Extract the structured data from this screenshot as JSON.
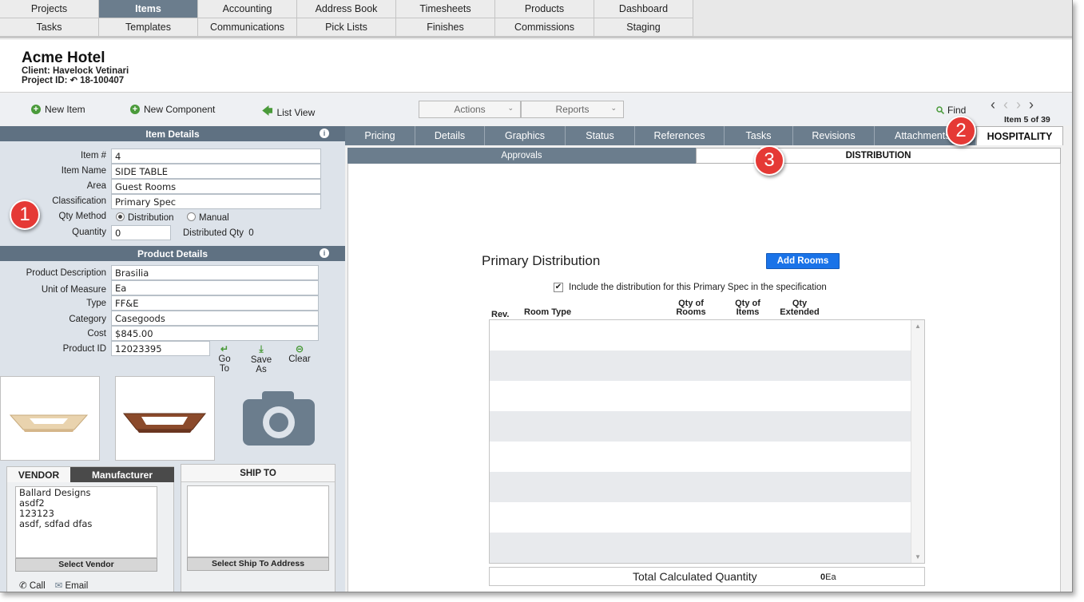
{
  "topnav": {
    "row1": [
      "Projects",
      "Items",
      "Accounting",
      "Address Book",
      "Timesheets",
      "Products",
      "Dashboard"
    ],
    "row2": [
      "Tasks",
      "Templates",
      "Communications",
      "Pick Lists",
      "Finishes",
      "Commissions",
      "Staging"
    ],
    "active": "Items"
  },
  "header": {
    "title": "Acme Hotel",
    "client": "Client: Havelock Vetinari",
    "project_label": "Project ID:",
    "project_id": "18-100407"
  },
  "toolbar": {
    "new_item": "New Item",
    "new_component": "New Component",
    "list_view": "List View",
    "actions": "Actions",
    "reports": "Reports",
    "find": "Find",
    "item_count": "Item 5 of 39"
  },
  "item_details": {
    "title": "Item Details",
    "fields": [
      {
        "label": "Item #",
        "value": "4"
      },
      {
        "label": "Item Name",
        "value": "SIDE TABLE"
      },
      {
        "label": "Area",
        "value": "Guest Rooms"
      },
      {
        "label": "Classification",
        "value": "Primary Spec"
      }
    ],
    "qty_method_label": "Qty Method",
    "qty_method_options": [
      "Distribution",
      "Manual"
    ],
    "qty_method_selected": "Distribution",
    "quantity_label": "Quantity",
    "quantity_value": "0",
    "distributed_qty_label": "Distributed Qty",
    "distributed_qty_value": "0"
  },
  "product_details": {
    "title": "Product Details",
    "fields": [
      {
        "label": "Product Description",
        "value": "Brasilia"
      },
      {
        "label": "Unit of Measure",
        "value": "Ea"
      },
      {
        "label": "Type",
        "value": "FF&E"
      },
      {
        "label": "Category",
        "value": "Casegoods"
      },
      {
        "label": "Cost",
        "value": "$845.00"
      }
    ],
    "product_id_label": "Product ID",
    "product_id_value": "12023395",
    "actions": [
      "Go To",
      "Save As",
      "Clear"
    ]
  },
  "vendor": {
    "tab_vendor": "VENDOR",
    "tab_manufacturer": "Manufacturer",
    "lines": [
      "Ballard Designs",
      "asdf2",
      "123123",
      "asdf, sdfad dfas"
    ],
    "select": "Select Vendor",
    "call": "Call",
    "email": "Email"
  },
  "ship_to": {
    "title": "SHIP TO",
    "select": "Select Ship To Address"
  },
  "tabs": [
    "Pricing",
    "Details",
    "Graphics",
    "Status",
    "References",
    "Tasks",
    "Revisions",
    "Attachments",
    "HOSPITALITY"
  ],
  "active_tab": "HOSPITALITY",
  "subtabs": [
    "Approvals",
    "DISTRIBUTION"
  ],
  "active_subtab": "DISTRIBUTION",
  "distribution": {
    "title": "Primary Distribution",
    "add_rooms": "Add Rooms",
    "include_text": "Include the distribution for this Primary Spec in the specification",
    "include_checked": true,
    "columns": {
      "rev": "Rev.",
      "room_type": "Room Type",
      "qty_rooms_1": "Qty of",
      "qty_rooms_2": "Rooms",
      "qty_items_1": "Qty of",
      "qty_items_2": "Items",
      "qty_ext_1": "Qty",
      "qty_ext_2": "Extended"
    },
    "total_label": "Total Calculated Quantity",
    "total_value": "0",
    "total_unit": "Ea"
  },
  "callouts": [
    "1",
    "2",
    "3"
  ],
  "colors": {
    "nav_active": "#6b7d8d",
    "section_bar": "#5f7182",
    "add_button": "#1a73e8",
    "callout": "#e53935",
    "icon_green": "#4a9a3a"
  }
}
